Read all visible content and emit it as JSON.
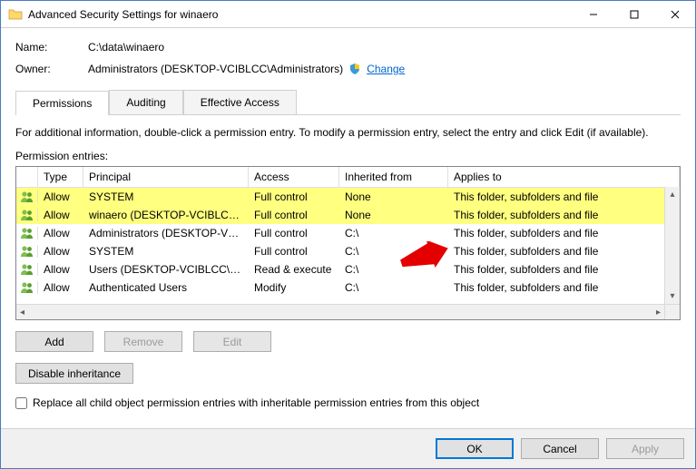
{
  "window": {
    "title": "Advanced Security Settings for winaero"
  },
  "meta": {
    "name_label": "Name:",
    "name_value": "C:\\data\\winaero",
    "owner_label": "Owner:",
    "owner_value": "Administrators (DESKTOP-VCIBLCC\\Administrators)",
    "change_link": "Change"
  },
  "tabs": {
    "permissions": "Permissions",
    "auditing": "Auditing",
    "effective": "Effective Access"
  },
  "info_text": "For additional information, double-click a permission entry. To modify a permission entry, select the entry and click Edit (if available).",
  "entries_label": "Permission entries:",
  "columns": {
    "type": "Type",
    "principal": "Principal",
    "access": "Access",
    "inherited": "Inherited from",
    "applies": "Applies to"
  },
  "rows": [
    {
      "type": "Allow",
      "principal": "SYSTEM",
      "access": "Full control",
      "inherited": "None",
      "applies": "This folder, subfolders and file",
      "hl": true
    },
    {
      "type": "Allow",
      "principal": "winaero (DESKTOP-VCIBLCC\\...",
      "access": "Full control",
      "inherited": "None",
      "applies": "This folder, subfolders and file",
      "hl": true
    },
    {
      "type": "Allow",
      "principal": "Administrators (DESKTOP-VCI...",
      "access": "Full control",
      "inherited": "C:\\",
      "applies": "This folder, subfolders and file",
      "hl": false
    },
    {
      "type": "Allow",
      "principal": "SYSTEM",
      "access": "Full control",
      "inherited": "C:\\",
      "applies": "This folder, subfolders and file",
      "hl": false
    },
    {
      "type": "Allow",
      "principal": "Users (DESKTOP-VCIBLCC\\Us...",
      "access": "Read & execute",
      "inherited": "C:\\",
      "applies": "This folder, subfolders and file",
      "hl": false
    },
    {
      "type": "Allow",
      "principal": "Authenticated Users",
      "access": "Modify",
      "inherited": "C:\\",
      "applies": "This folder, subfolders and file",
      "hl": false
    }
  ],
  "buttons": {
    "add": "Add",
    "remove": "Remove",
    "edit": "Edit",
    "disable_inheritance": "Disable inheritance"
  },
  "replace_checkbox": "Replace all child object permission entries with inheritable permission entries from this object",
  "footer": {
    "ok": "OK",
    "cancel": "Cancel",
    "apply": "Apply"
  }
}
